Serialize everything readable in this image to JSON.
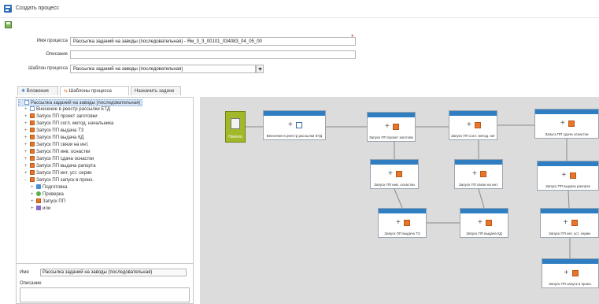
{
  "window": {
    "title": "Создать процесс"
  },
  "form": {
    "name_label": "Имя процесса",
    "name_value": "Рассылка заданий на заводы (последовательная) - Ям_3_3_00101_034083_04_05_00",
    "description_label": "Описание",
    "description_value": "",
    "template_label": "Шаблон процесса",
    "template_value": "Рассылка заданий на заводы (последовательная)"
  },
  "tabs": [
    {
      "label": "Вложения"
    },
    {
      "label": "Шаблоны процесса"
    },
    {
      "label": "Назначить задачи"
    }
  ],
  "tree": [
    {
      "label": "Рассылка заданий на заводы (последовательная)",
      "icon": "folder",
      "level": 0,
      "exp": "-"
    },
    {
      "label": "Внесение в реестр рассылки ЕТД",
      "icon": "doc",
      "level": 1,
      "exp": "+"
    },
    {
      "label": "Запуск ПП проект заготовки",
      "icon": "orange",
      "level": 1,
      "exp": "+"
    },
    {
      "label": "Запуск ПП согл. метод. начальника",
      "icon": "orange",
      "level": 1,
      "exp": "+"
    },
    {
      "label": "Запуск ПП выдача ТЗ",
      "icon": "orange",
      "level": 1,
      "exp": "+"
    },
    {
      "label": "Запуск ПП выдача КД",
      "icon": "orange",
      "level": 1,
      "exp": "+"
    },
    {
      "label": "Запуск ПП связи на инт.",
      "icon": "orange",
      "level": 1,
      "exp": "+"
    },
    {
      "label": "Запуск ПП инв. оснастки",
      "icon": "orange",
      "level": 1,
      "exp": "+"
    },
    {
      "label": "Запуск ПП сдача оснастки",
      "icon": "orange",
      "level": 1,
      "exp": "+"
    },
    {
      "label": "Запуск ПП выдача рапорта",
      "icon": "orange",
      "level": 1,
      "exp": "+"
    },
    {
      "label": "Запуск ПП инт. уст. серии",
      "icon": "orange",
      "level": 1,
      "exp": "+"
    },
    {
      "label": "Запуск ПП запуск в произ.",
      "icon": "orange",
      "level": 1,
      "exp": "-"
    },
    {
      "label": "Подготовка",
      "icon": "blue",
      "level": 2,
      "exp": "+"
    },
    {
      "label": "Проверка",
      "icon": "green",
      "level": 2,
      "exp": "+"
    },
    {
      "label": "Запуск ПП",
      "icon": "orange",
      "level": 2,
      "exp": "+"
    },
    {
      "label": "или",
      "icon": "purple",
      "level": 2,
      "exp": "+"
    }
  ],
  "details": {
    "name_label": "Имя",
    "name_value": "Рассылка заданий на заводы (последовательная)",
    "description_label": "Описание"
  },
  "workflow": {
    "start_label": "Начало",
    "nodes": [
      {
        "id": "n1",
        "label": "Внесение в реестр рассылки ЕТД",
        "icon": "doc"
      },
      {
        "id": "n2",
        "label": "Запуск ПП проект заготовки",
        "icon": "orange"
      },
      {
        "id": "n3",
        "label": "Запуск ПП согл. метод. нач.",
        "icon": "orange"
      },
      {
        "id": "n4",
        "label": "Запуск ПП сдача оснастки",
        "icon": "orange"
      },
      {
        "id": "n5",
        "label": "Запуск ПП инв. оснастки",
        "icon": "orange"
      },
      {
        "id": "n6",
        "label": "Запуск ПП связи на инт.",
        "icon": "orange"
      },
      {
        "id": "n7",
        "label": "Запуск ПП выдача рапорта",
        "icon": "orange"
      },
      {
        "id": "n8",
        "label": "Запуск ПП выдача ТЗ",
        "icon": "orange"
      },
      {
        "id": "n9",
        "label": "Запуск ПП выдача КД",
        "icon": "orange"
      },
      {
        "id": "n10",
        "label": "Запуск ПП инт. уст. серии",
        "icon": "orange"
      },
      {
        "id": "n11",
        "label": "Запуск ПП запуск в произ.",
        "icon": "orange"
      }
    ]
  },
  "colors": {
    "node_header": "#2f7ec2",
    "canvas_bg": "#dcdcdc",
    "start_node": "#a2b82a",
    "required_marker": "#e03030"
  }
}
